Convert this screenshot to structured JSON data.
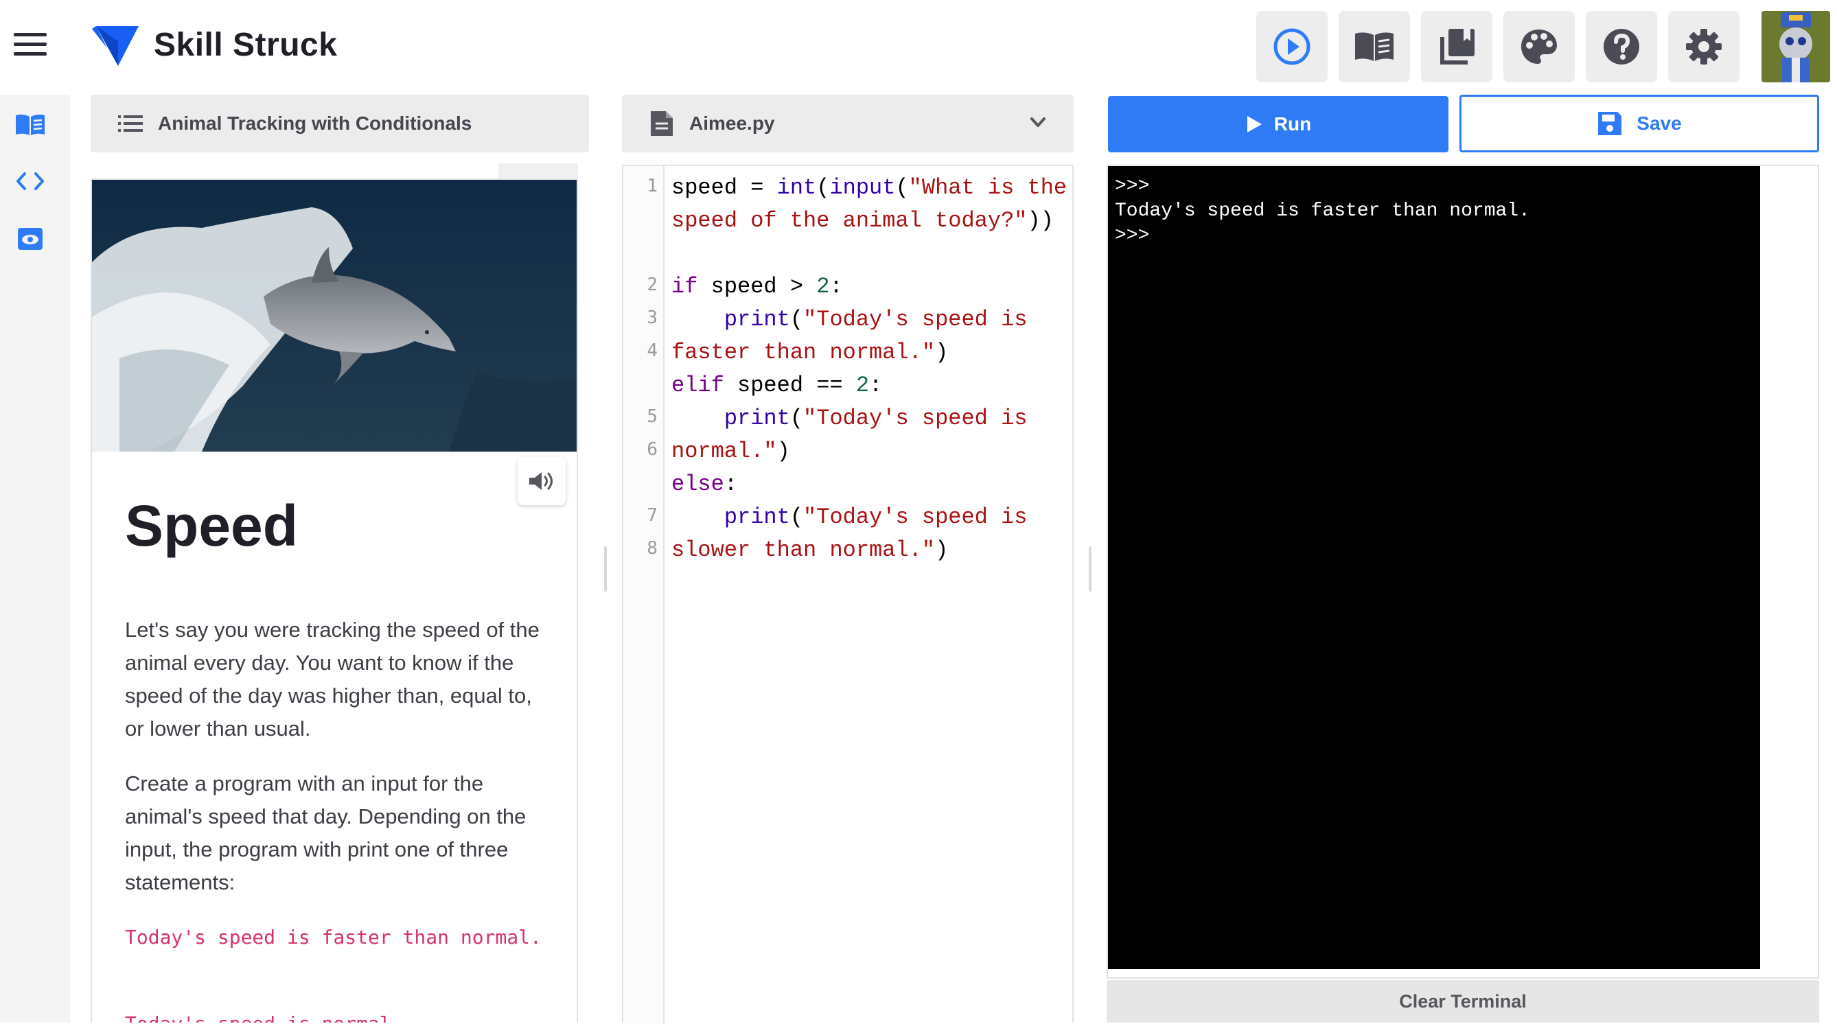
{
  "app": {
    "brand": "Skill Struck"
  },
  "toolbar": {
    "buttons": [
      {
        "name": "run-preview",
        "icon": "play-circle-icon"
      },
      {
        "name": "reader",
        "icon": "open-book-icon"
      },
      {
        "name": "library",
        "icon": "book-stack-icon"
      },
      {
        "name": "theme",
        "icon": "palette-icon"
      },
      {
        "name": "help",
        "icon": "help-icon"
      },
      {
        "name": "settings",
        "icon": "gear-icon"
      }
    ]
  },
  "sidebar": {
    "items": [
      "book-icon",
      "code-icon",
      "eye-icon"
    ]
  },
  "lesson": {
    "title": "Animal Tracking with Conditionals",
    "heading": "Speed",
    "paragraphs": [
      "Let's say you were tracking the speed of the animal every day. You want to know if the speed of the day was higher than, equal to, or lower than usual.",
      "Create a program with an input for the animal's speed that day. Depending on the input, the program with print one of three statements:"
    ],
    "code_examples": [
      "Today's speed is faster than normal.",
      "Today's speed is normal."
    ]
  },
  "editor": {
    "filename": "Aimee.py",
    "line_numbers": [
      "1",
      "2",
      "3",
      "4",
      "5",
      "6",
      "7",
      "8"
    ],
    "code": [
      "speed = int(input(\"What is the speed of the animal today?\"))",
      "",
      "if speed > 2:",
      "    print(\"Today's speed is faster than normal.\")",
      "elif speed == 2:",
      "    print(\"Today's speed is normal.\")",
      "else:",
      "    print(\"Today's speed is slower than normal.\")"
    ]
  },
  "actions": {
    "run_label": "Run",
    "save_label": "Save",
    "clear_label": "Clear Terminal"
  },
  "terminal": {
    "lines": [
      ">>>",
      "Today's speed is faster than normal.",
      ">>>"
    ]
  },
  "colors": {
    "accent": "#2f7bf5",
    "keyword": "#770088",
    "builtin": "#3300aa",
    "string": "#aa1111",
    "number": "#116644",
    "inline_code": "#d6336c"
  }
}
